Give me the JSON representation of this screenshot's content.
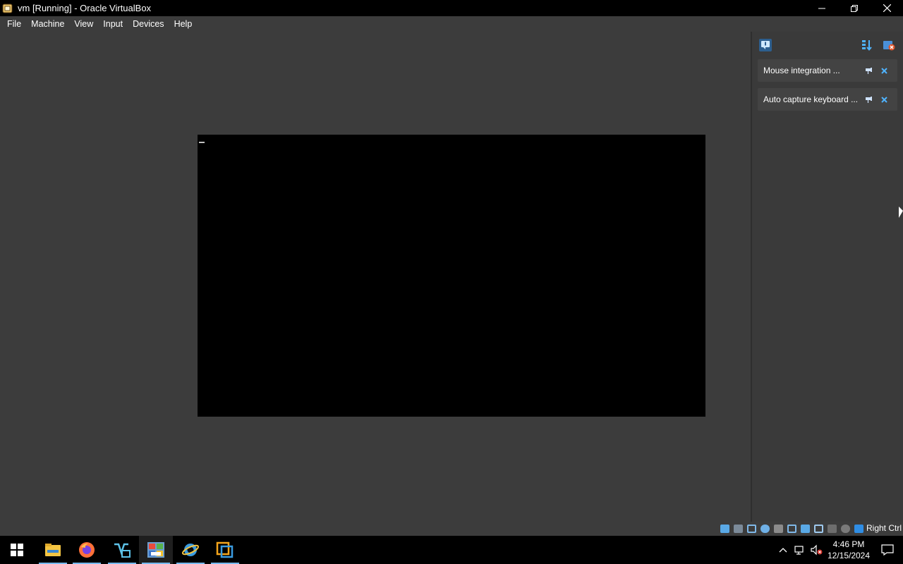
{
  "window": {
    "title": "vm [Running] - Oracle VirtualBox",
    "icon": "virtualbox-app-icon",
    "controls": {
      "minimize_icon": "minimize-icon",
      "restore_icon": "restore-icon",
      "close_icon": "close-icon"
    }
  },
  "menu": {
    "items": [
      "File",
      "Machine",
      "View",
      "Input",
      "Devices",
      "Help"
    ]
  },
  "notifications": {
    "header_icons": [
      "notification-center-icon",
      "sort-icon",
      "dismiss-all-icon"
    ],
    "items": [
      {
        "text": "Mouse integration ...",
        "pin_icon": "pin-icon",
        "close_icon": "close-icon"
      },
      {
        "text": "Auto capture keyboard ...",
        "pin_icon": "pin-icon",
        "close_icon": "close-icon"
      }
    ]
  },
  "statusbar": {
    "icons": [
      "hard-disk-icon",
      "optical-drive-icon",
      "network-icon",
      "usb-icon",
      "shared-folders-icon",
      "display-icon",
      "recording-icon",
      "virtualization-icon",
      "cpu-icon",
      "mouse-integration-icon",
      "keyboard-capture-icon"
    ],
    "host_key": "Right Ctrl"
  },
  "taskbar": {
    "start_icon": "windows-start-icon",
    "apps": [
      {
        "name": "File Explorer",
        "icon": "file-explorer-icon",
        "running": true
      },
      {
        "name": "Firefox",
        "icon": "firefox-icon",
        "running": true
      },
      {
        "name": "Visual Studio",
        "icon": "visual-studio-icon",
        "running": true
      },
      {
        "name": "Windows 2000",
        "icon": "windows-2000-icon",
        "running": true,
        "active": true
      },
      {
        "name": "Internet Explorer",
        "icon": "internet-explorer-icon",
        "running": true
      },
      {
        "name": "VirtualBox",
        "icon": "virtualbox-icon",
        "running": true
      }
    ],
    "tray": {
      "icons": [
        "chevron-up-icon",
        "network-icon",
        "volume-muted-icon"
      ],
      "time": "4:46 PM",
      "date": "12/15/2024",
      "notification_icon": "action-center-icon"
    }
  },
  "colors": {
    "background": "#3c3c3c",
    "vm_screen": "#000000",
    "accent": "#4fb3ff",
    "taskbar_underline": "#76b9ed"
  }
}
